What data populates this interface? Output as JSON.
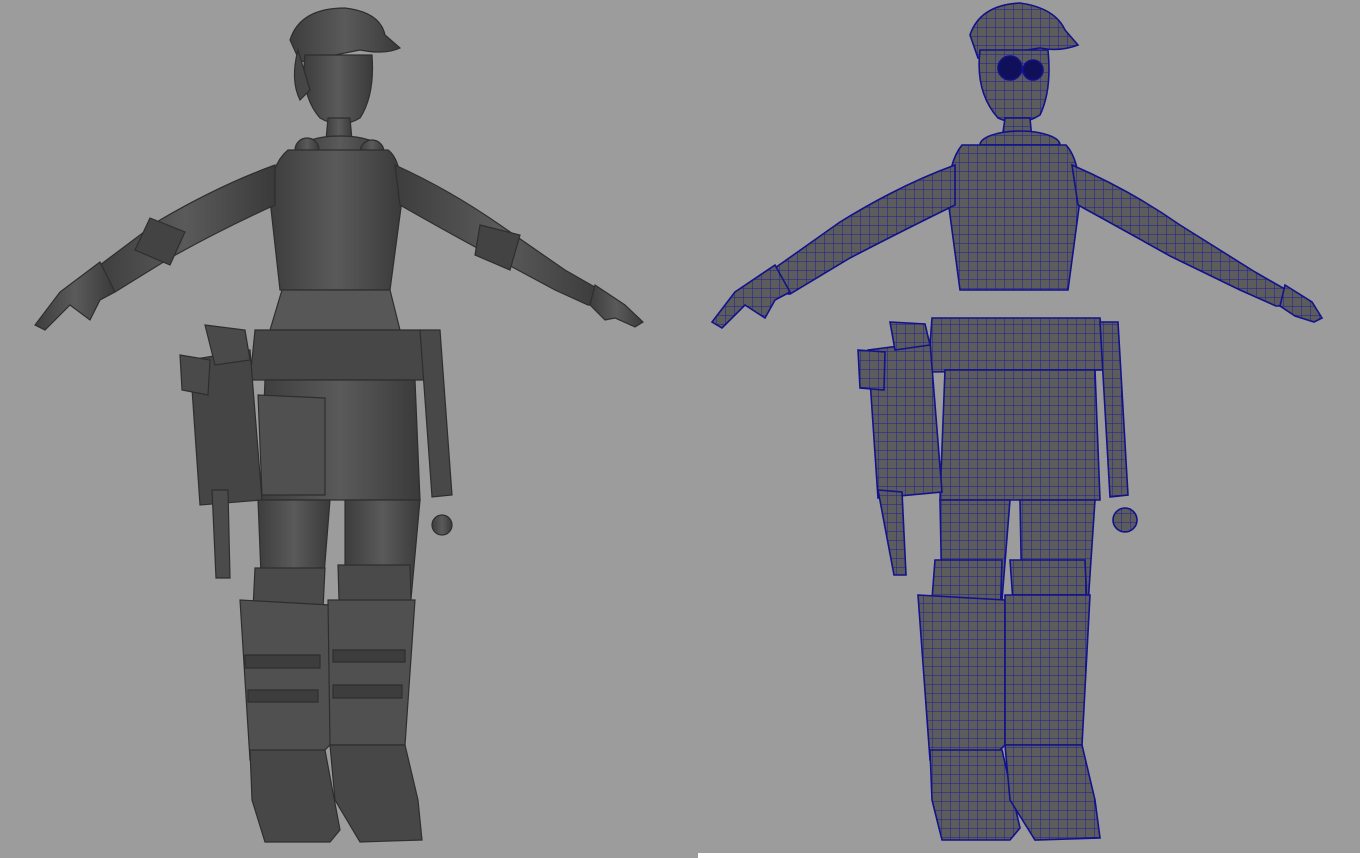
{
  "viewport": {
    "background": "#9c9c9c",
    "panels": [
      {
        "id": "shaded",
        "mode": "smooth-shaded",
        "model_color": "#4e4e4e"
      },
      {
        "id": "wireframe",
        "mode": "wireframe-on-shaded",
        "model_color": "#5a5a5a",
        "wire_color": "#1a1a9a"
      }
    ]
  }
}
